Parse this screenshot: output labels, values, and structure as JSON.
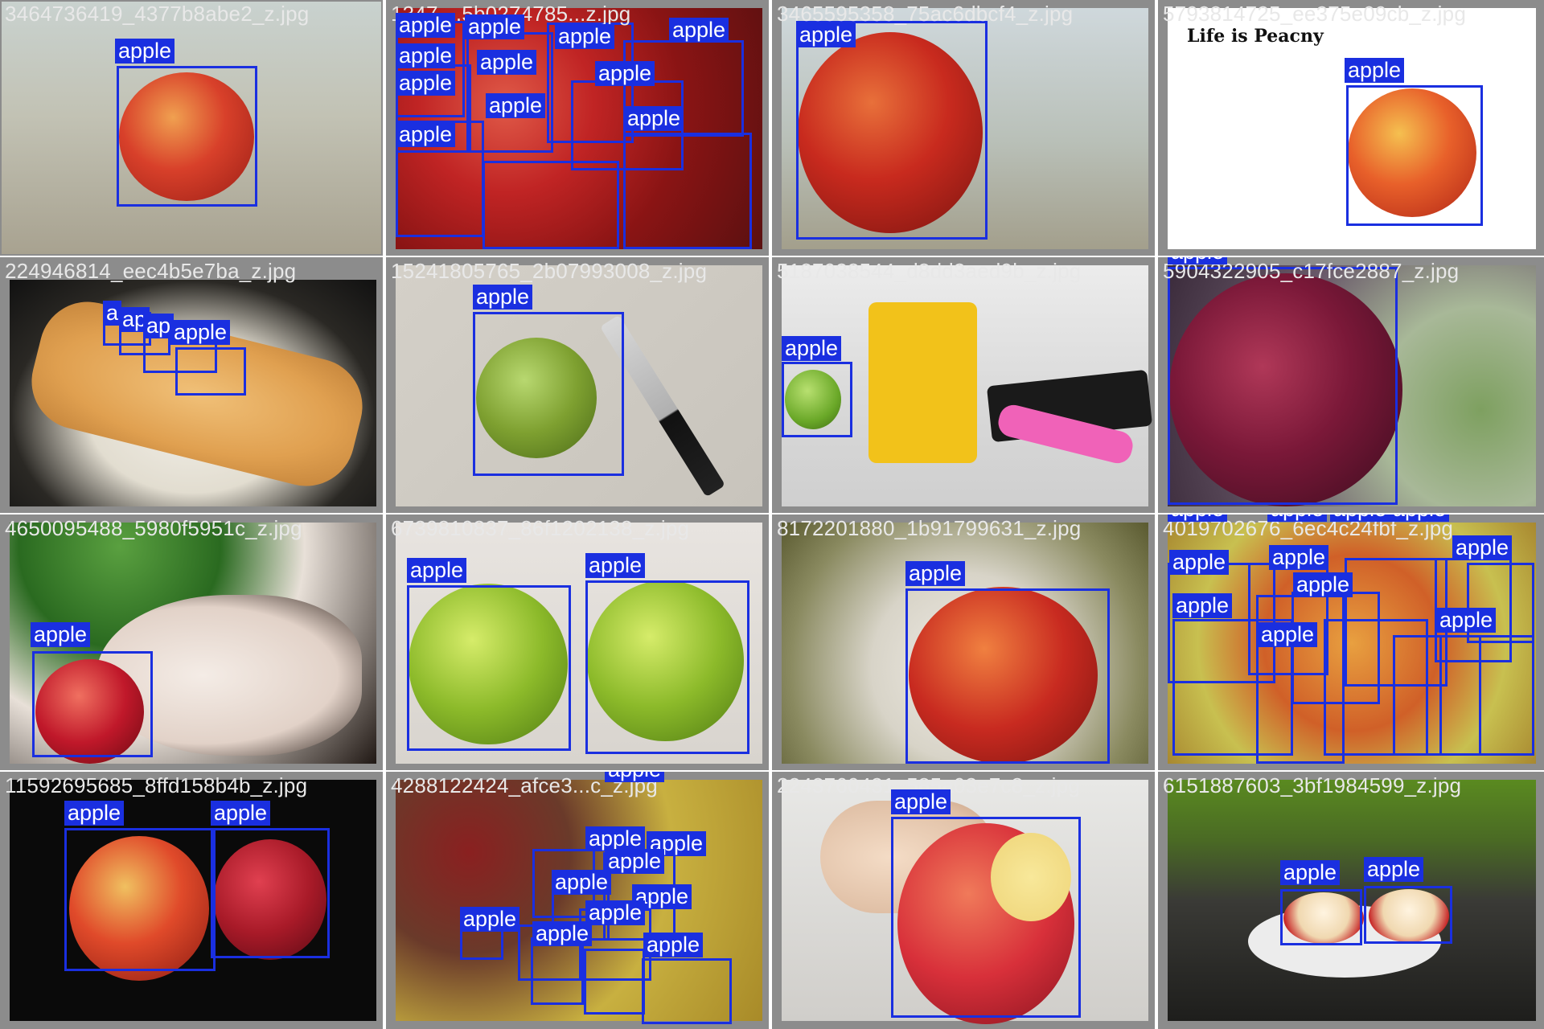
{
  "colors": {
    "box": "#1a2fe0",
    "label_text": "#ffffff",
    "tile_bg": "#8c8c8c",
    "filename_text": "#e8e8e8"
  },
  "tiles": [
    {
      "filename": "3464736419_4377b8abe2_z.jpg",
      "labels": [
        "apple"
      ]
    },
    {
      "filename": "1347....5b0274785...z.jpg",
      "labels": [
        "apple",
        "apple",
        "apple",
        "apple",
        "apple",
        "apple",
        "apple",
        "apple",
        "apple",
        "apple",
        "apple"
      ]
    },
    {
      "filename": "3465595358_75ac6dbcf4_z.jpg",
      "labels": [
        "apple"
      ]
    },
    {
      "filename": "5793814725_ee375e09cb_z.jpg",
      "caption": "Life is Peacny",
      "labels": [
        "apple"
      ]
    },
    {
      "filename": "224946814_eec4b5e7ba_z.jpg",
      "labels": [
        "a",
        "ap",
        "ap",
        "apple"
      ]
    },
    {
      "filename": "15241805765_2b07993008_z.jpg",
      "labels": [
        "apple"
      ]
    },
    {
      "filename": "5187038544_d8dd3aed9b_z.jpg",
      "labels": [
        "apple"
      ]
    },
    {
      "filename": "5904322905_c17fce2887_z.jpg",
      "labels": [
        "apple"
      ]
    },
    {
      "filename": "4650095488_5980f5951c_z.jpg",
      "labels": [
        "apple"
      ]
    },
    {
      "filename": "6739810837_86f1202138_z.jpg",
      "labels": [
        "apple",
        "apple"
      ]
    },
    {
      "filename": "8172201880_1b91799631_z.jpg",
      "labels": [
        "apple"
      ]
    },
    {
      "filename": "4019702676_6ec4c24fbf_z.jpg",
      "labels": [
        "apple",
        "apple",
        "apple",
        "apple",
        "apple",
        "apple",
        "apple",
        "apple",
        "apple",
        "apple",
        "apple"
      ]
    },
    {
      "filename": "11592695685_8ffd158b4b_z.jpg",
      "labels": [
        "apple",
        "apple"
      ]
    },
    {
      "filename": "4288122424_afce3...c_z.jpg",
      "labels": [
        "apple",
        "apple",
        "apple",
        "apple",
        "apple",
        "apple",
        "apple",
        "apple",
        "apple",
        "apple"
      ]
    },
    {
      "filename": "2243760431_585a03e7c8_z.jpg",
      "labels": [
        "apple"
      ]
    },
    {
      "filename": "6151887603_3bf1984599_z.jpg",
      "labels": [
        "apple",
        "apple"
      ]
    }
  ]
}
